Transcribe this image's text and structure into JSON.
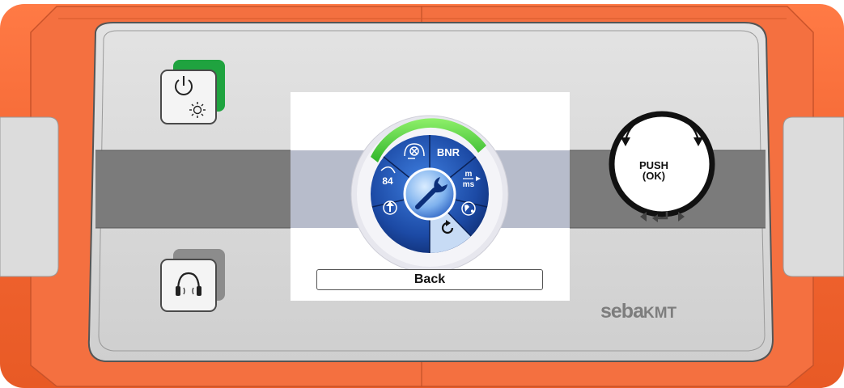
{
  "device": {
    "brand_logo": "sebaKMT",
    "brand_logo_prefix": "seba",
    "brand_logo_suffix": "KMT"
  },
  "rotary_knob": {
    "push_label_line1": "PUSH",
    "push_label_line2": "(OK)",
    "nav_hint_icons": [
      "arrow-left-icon",
      "enter-icon",
      "arrow-right-icon"
    ]
  },
  "left_buttons": {
    "power_button_icons": [
      "power-icon",
      "brightness-icon"
    ],
    "headphones_button_icon": "headphones-icon"
  },
  "screen": {
    "menu_wheel": {
      "center_icon": "wrench-icon",
      "segments": [
        {
          "name": "headset-mute",
          "icon": "headset-mute-icon",
          "label": ""
        },
        {
          "name": "bnr",
          "icon": "",
          "label": "BNR"
        },
        {
          "name": "units",
          "icon": "units-icon",
          "label_top": "m",
          "label_bottom": "ms"
        },
        {
          "name": "globe",
          "icon": "globe-icon",
          "label": ""
        },
        {
          "name": "reset",
          "icon": "refresh-icon",
          "label": ""
        },
        {
          "name": "upload",
          "icon": "up-arrow-icon",
          "label": ""
        },
        {
          "name": "ear-level",
          "icon": "ear-icon",
          "label": "84"
        }
      ],
      "selected_segment": "reset"
    },
    "back_label": "Back"
  },
  "colors": {
    "housing_orange": "#f26a33",
    "panel_gray": "#d6d6d6",
    "stripe_gray": "#7b7b7b",
    "power_indicator_green": "#1fa33f",
    "wheel_blue": "#1e4fa8",
    "wheel_ring_green": "#5fd13c"
  }
}
